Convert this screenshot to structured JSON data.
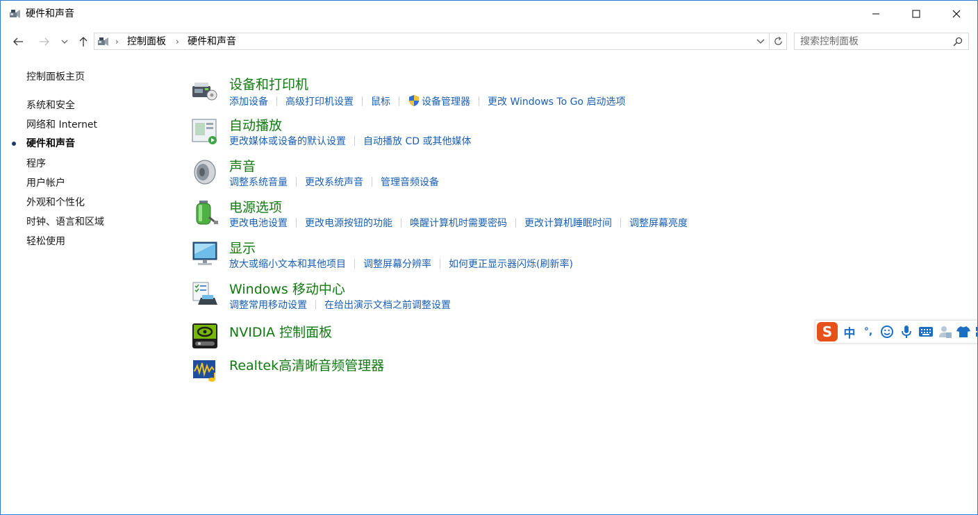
{
  "window": {
    "title": "硬件和声音",
    "minimize_glyph": "—",
    "maximize_glyph": "☐",
    "close_glyph": "✕"
  },
  "nav": {
    "back_icon": "arrow-left-icon",
    "forward_icon": "arrow-right-icon",
    "recent_icon": "chevron-down-icon",
    "up_icon": "arrow-up-icon"
  },
  "address": {
    "crumbs": [
      "控制面板",
      "硬件和声音"
    ],
    "separator": "›"
  },
  "search": {
    "placeholder": "搜索控制面板"
  },
  "sidebar": {
    "home": "控制面板主页",
    "items": [
      {
        "label": "系统和安全",
        "current": false
      },
      {
        "label": "网络和 Internet",
        "current": false
      },
      {
        "label": "硬件和声音",
        "current": true
      },
      {
        "label": "程序",
        "current": false
      },
      {
        "label": "用户帐户",
        "current": false
      },
      {
        "label": "外观和个性化",
        "current": false
      },
      {
        "label": "时钟、语言和区域",
        "current": false
      },
      {
        "label": "轻松使用",
        "current": false
      }
    ]
  },
  "categories": [
    {
      "title": "设备和打印机",
      "icon": "devices-printers-icon",
      "links": [
        "添加设备",
        "高级打印机设置",
        "鼠标",
        "设备管理器",
        "更改 Windows To Go 启动选项"
      ]
    },
    {
      "title": "自动播放",
      "icon": "autoplay-icon",
      "links": [
        "更改媒体或设备的默认设置",
        "自动播放 CD 或其他媒体"
      ]
    },
    {
      "title": "声音",
      "icon": "speaker-icon",
      "links": [
        "调整系统音量",
        "更改系统声音",
        "管理音频设备"
      ]
    },
    {
      "title": "电源选项",
      "icon": "battery-icon",
      "links": [
        "更改电池设置",
        "更改电源按钮的功能",
        "唤醒计算机时需要密码",
        "更改计算机睡眠时间",
        "调整屏幕亮度"
      ]
    },
    {
      "title": "显示",
      "icon": "monitor-icon",
      "links": [
        "放大或缩小文本和其他项目",
        "调整屏幕分辨率",
        "如何更正显示器闪烁(刷新率)"
      ]
    },
    {
      "title": "Windows 移动中心",
      "icon": "mobility-center-icon",
      "links": [
        "调整常用移动设置",
        "在给出演示文档之前调整设置"
      ]
    },
    {
      "title": "NVIDIA 控制面板",
      "icon": "nvidia-icon",
      "links": []
    },
    {
      "title": "Realtek高清晰音频管理器",
      "icon": "realtek-audio-icon",
      "links": []
    }
  ],
  "ime": {
    "logo": "S",
    "mode": "中",
    "punct": "°,",
    "icons": [
      "emoji-icon",
      "microphone-icon",
      "keyboard-icon",
      "user-icon",
      "shirt-icon",
      "grid-icon"
    ]
  },
  "colors": {
    "category_title": "#0f7a0f",
    "link": "#1a5fb4",
    "window_border": "#2b7bd0",
    "ime_accent": "#e8501a"
  }
}
